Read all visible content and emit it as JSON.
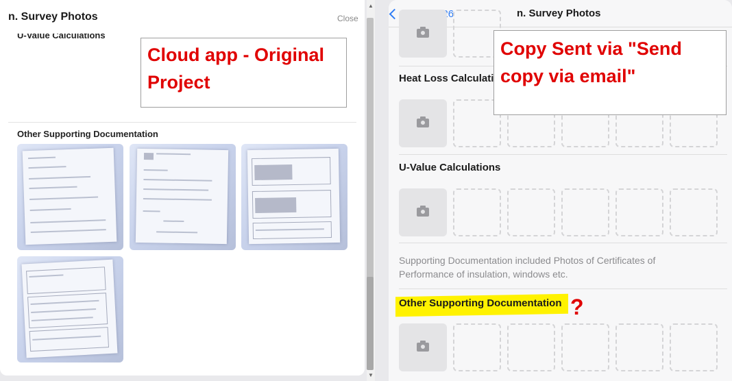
{
  "left_panel": {
    "title": "n. Survey Photos",
    "close_label": "Close",
    "cut_heading": "U-Value Calculations",
    "section_heading": "Other Supporting Documentation",
    "annotation": "Cloud app - Original Project"
  },
  "right_panel": {
    "back_label": "WH569226",
    "title": "n. Survey Photos",
    "sections": [
      {
        "heading": "Heat Loss Calculations"
      },
      {
        "heading": "U-Value Calculations"
      },
      {
        "heading": "Other Supporting Documentation"
      }
    ],
    "note": "Supporting Documentation included Photos of Certificates of Performance of insulation, windows etc.",
    "annotation": "Copy Sent via \"Send copy via email\"",
    "question_mark": "?"
  },
  "icons": {
    "camera": "camera-icon",
    "back": "chevron-left-icon"
  },
  "colors": {
    "accent": "#2f7df6",
    "annotation_red": "#e00000",
    "highlight": "#fff200"
  }
}
